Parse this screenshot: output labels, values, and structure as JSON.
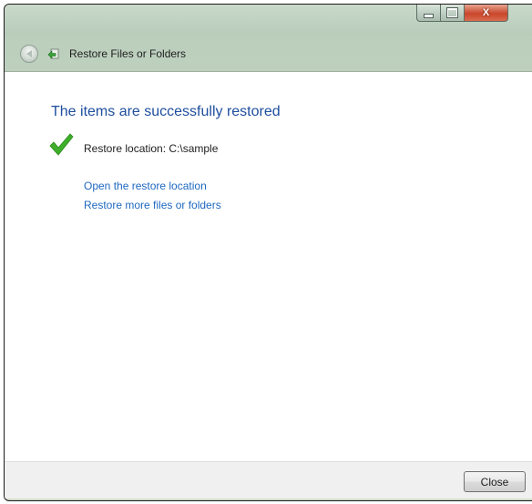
{
  "window": {
    "caption_buttons": {
      "minimize": "minimize",
      "maximize": "maximize",
      "close": "X"
    }
  },
  "nav": {
    "title": "Restore Files or Folders"
  },
  "main": {
    "heading": "The items are successfully restored",
    "location_text": "Restore location: C:\\sample",
    "links": {
      "open_location": "Open the restore location",
      "restore_more": "Restore more files or folders"
    }
  },
  "footer": {
    "close_label": "Close"
  },
  "colors": {
    "heading": "#1e4e9e",
    "link": "#1e68c0",
    "success_check": "#3fae2a"
  },
  "icons": {
    "back": "back-arrow-icon",
    "app": "restore-files-icon",
    "success": "checkmark-icon"
  }
}
